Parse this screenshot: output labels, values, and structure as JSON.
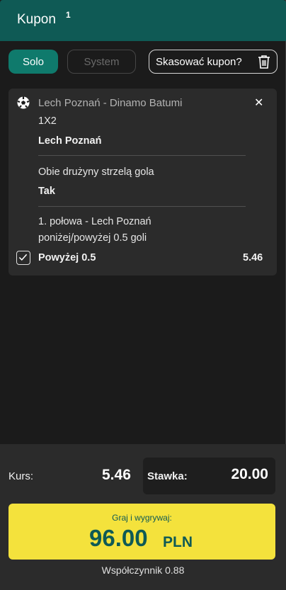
{
  "header": {
    "title": "Kupon",
    "count": "1"
  },
  "tabs": {
    "solo": "Solo",
    "system": "System"
  },
  "clear_coupon": "Skasować kupon?",
  "bet": {
    "event": "Lech Poznań - Dinamo Batumi",
    "markets": [
      {
        "market": "1X2",
        "selection": "Lech Poznań"
      },
      {
        "market": "Obie drużyny strzelą gola",
        "selection": "Tak"
      },
      {
        "market_line1": "1. połowa - Lech Poznań",
        "market_line2": "poniżej/powyżej 0.5 goli",
        "selection": "Powyżej 0.5"
      }
    ],
    "odds": "5.46"
  },
  "footer": {
    "kurs_label": "Kurs:",
    "kurs_value": "5.46",
    "stake_label": "Stawka:",
    "stake_value": "20.00",
    "cta_label": "Graj i wygrywaj:",
    "cta_amount": "96.00",
    "cta_currency": "PLN",
    "coefficient": "Współczynnik 0.88"
  },
  "colors": {
    "brand": "#0f5a55",
    "solo_active": "#0f7a6c",
    "cta": "#f4e23c"
  },
  "icons": [
    "trash-icon",
    "soccer-ball-icon",
    "close-icon",
    "checkbox-checked-icon"
  ]
}
